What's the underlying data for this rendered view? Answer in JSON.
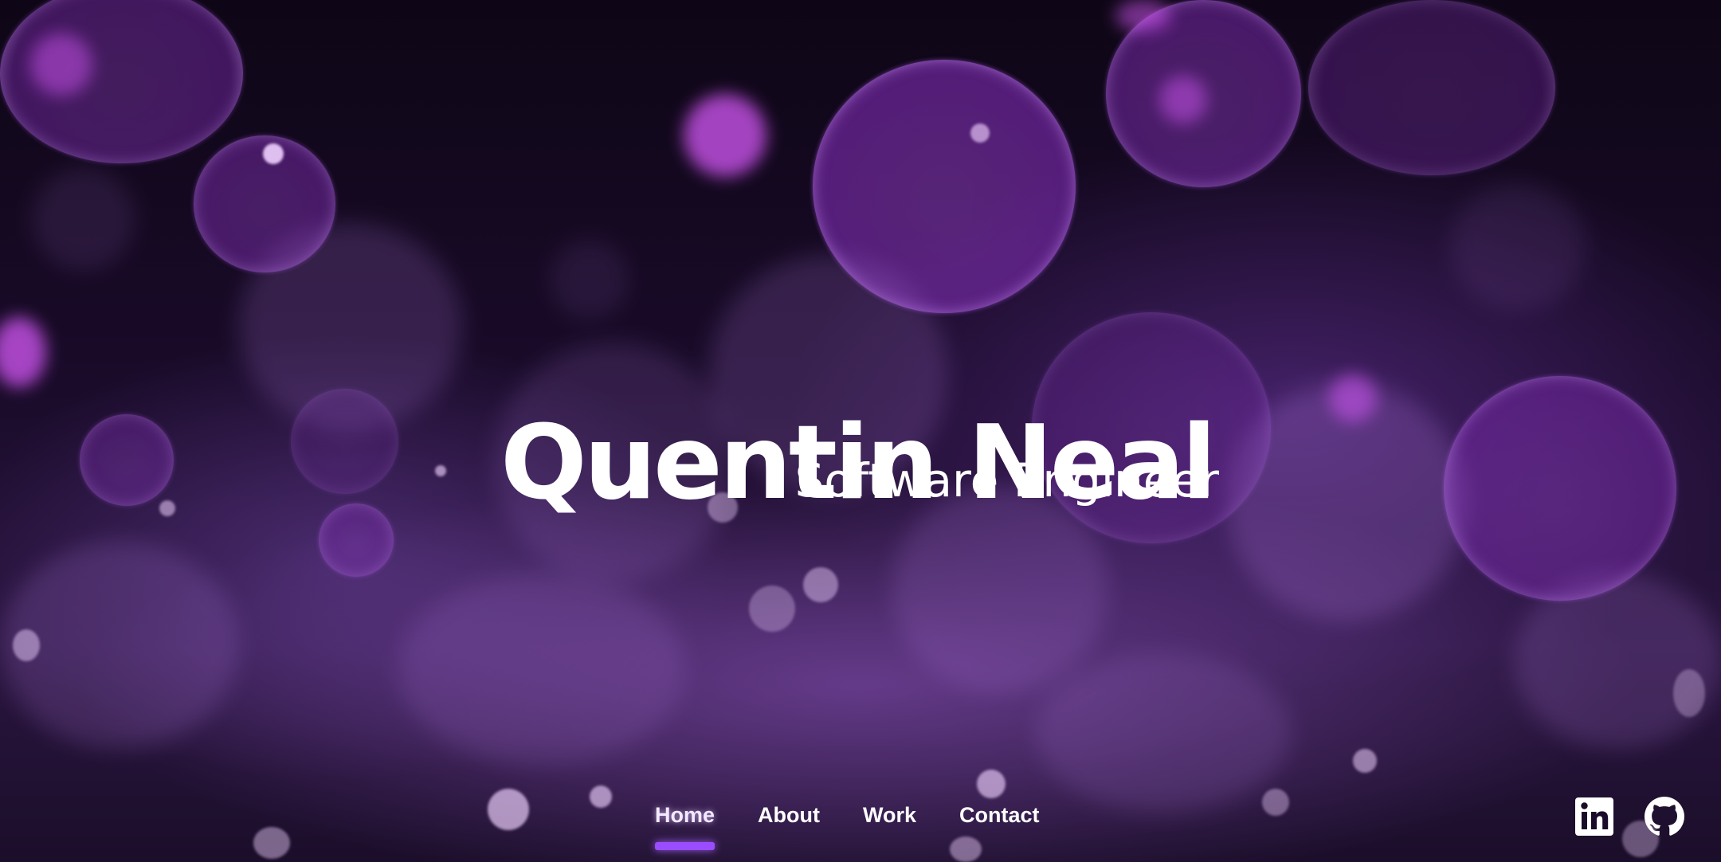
{
  "hero": {
    "name": "Quentin Neal",
    "role": "Software Engineer"
  },
  "nav": {
    "items": [
      {
        "label": "Home",
        "active": true
      },
      {
        "label": "About",
        "active": false
      },
      {
        "label": "Work",
        "active": false
      },
      {
        "label": "Contact",
        "active": false
      }
    ]
  },
  "socials": [
    {
      "icon": "linkedin-icon"
    },
    {
      "icon": "github-icon"
    }
  ],
  "colors": {
    "background": "#0c0514",
    "bubble": "#8a3cc8",
    "active_underline": "#9a4dff",
    "text": "#ffffff"
  }
}
